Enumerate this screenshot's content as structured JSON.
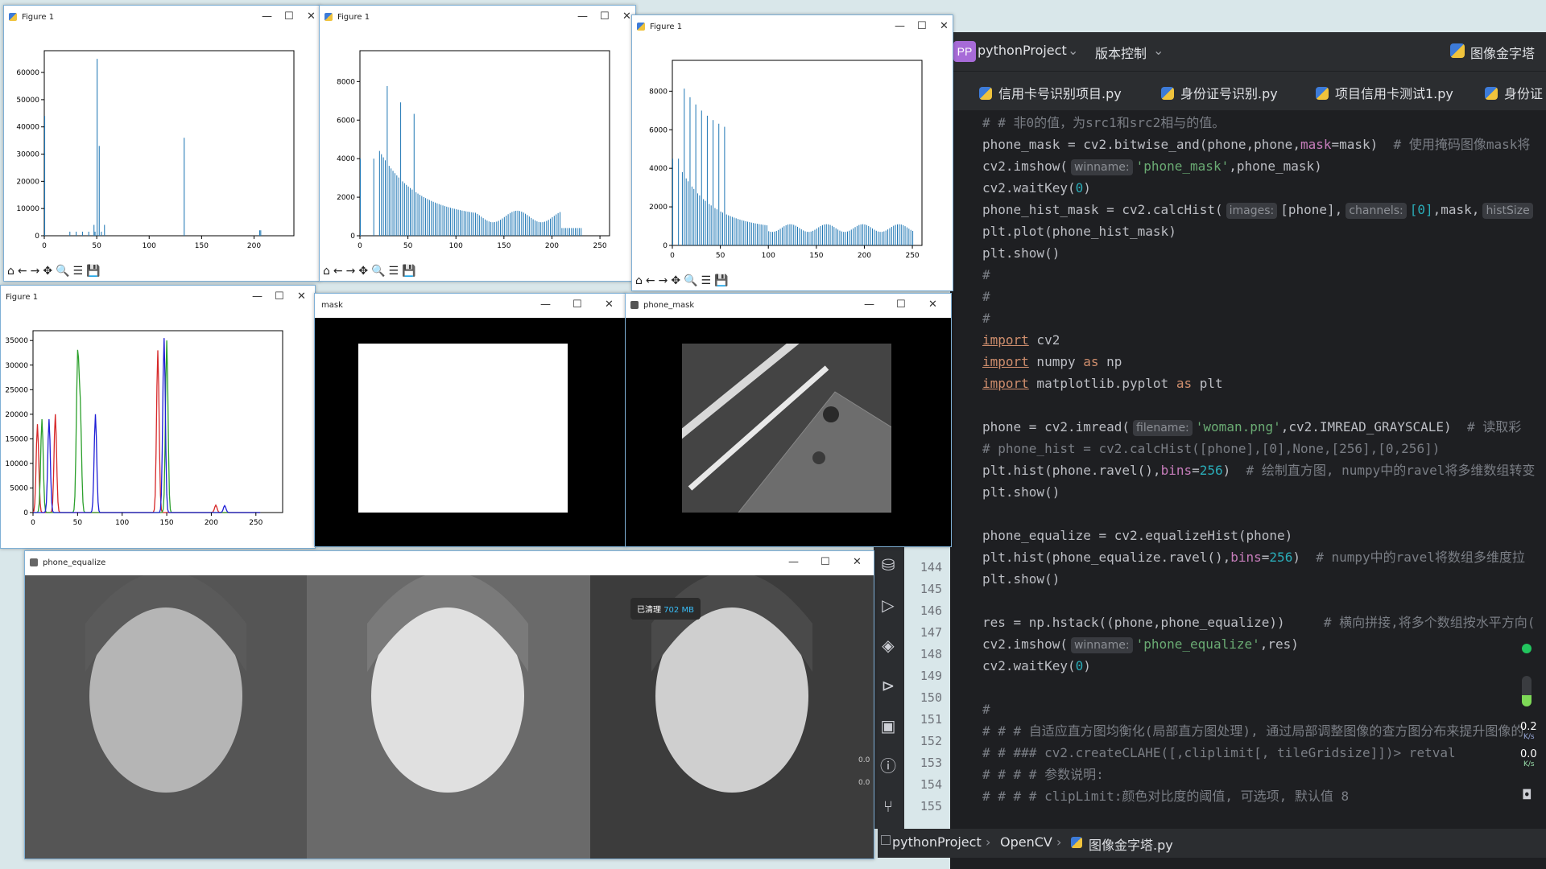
{
  "windows": {
    "fig1": {
      "title": "Figure 1",
      "yticks": [
        "0",
        "10000",
        "20000",
        "30000",
        "40000",
        "50000",
        "60000"
      ],
      "xticks": [
        "0",
        "50",
        "100",
        "150",
        "200"
      ]
    },
    "fig2": {
      "title": "Figure 1",
      "yticks": [
        "0",
        "2000",
        "4000",
        "6000",
        "8000"
      ],
      "xticks": [
        "0",
        "50",
        "100",
        "150",
        "200",
        "250"
      ]
    },
    "fig3": {
      "title": "Figure 1",
      "yticks": [
        "0",
        "2000",
        "4000",
        "6000",
        "8000"
      ],
      "xticks": [
        "0",
        "50",
        "100",
        "150",
        "200",
        "250"
      ]
    },
    "fig4": {
      "title": "Figure 1",
      "yticks": [
        "0",
        "5000",
        "10000",
        "15000",
        "20000",
        "25000",
        "30000",
        "35000"
      ],
      "xticks": [
        "0",
        "50",
        "100",
        "150",
        "200",
        "250"
      ]
    },
    "mask": {
      "title": "mask"
    },
    "phone_mask": {
      "title": "phone_mask"
    },
    "phone_equalize": {
      "title": "phone_equalize"
    },
    "controls": {
      "minimize": "—",
      "maximize": "☐",
      "close": "✕"
    },
    "toolbar": [
      "⌂",
      "←",
      "→",
      "✥",
      "🔍",
      "☰",
      "💾"
    ]
  },
  "cleanup_toast": {
    "label": "已清理",
    "value": "702 MB"
  },
  "net_speed": {
    "up": "0.2",
    "up_unit": "K/s",
    "down": "0.0",
    "down_unit": "K/s",
    "small_up": "0.0",
    "small_down": "0.0"
  },
  "ide": {
    "project_badge": "PP",
    "project_name": "pythonProject",
    "vcs": "版本控制",
    "current_file_top": "图像金字塔",
    "tabs": [
      "信用卡号识别项目.py",
      "身份证号识别.py",
      "项目信用卡测试1.py",
      "身份证"
    ],
    "breadcrumb": [
      "pythonProject",
      "OpenCV",
      "图像金字塔.py"
    ],
    "line_numbers": [
      "144",
      "145",
      "146",
      "147",
      "148",
      "149",
      "150",
      "151",
      "152",
      "153",
      "154",
      "155"
    ],
    "hints": {
      "winname": "winname:",
      "images": "images:",
      "channels": "channels:",
      "histsize": "histSize",
      "filename": "filename:"
    },
    "code": {
      "l1": "# # 非0的值，为src1和src2相与的值。",
      "l2a": "phone_mask = cv2.bitwise_and(phone,phone,",
      "l2b": "mask",
      "l2c": "=mask)  ",
      "l2d": "# 使用掩码图像mask将",
      "l3a": "cv2.imshow(",
      "l3b": "'phone_mask'",
      "l3c": ",phone_mask)",
      "l4a": "cv2.waitKey(",
      "l4b": "0",
      "l4c": ")",
      "l5a": "phone_hist_mask = cv2.calcHist(",
      "l5b": "[phone],",
      "l5c": "[0]",
      "l5d": ",mask,",
      "l6": "plt.plot(phone_hist_mask)",
      "l7": "plt.show()",
      "l8": "#",
      "l9": "#",
      "l10": "#",
      "l11a": "import",
      "l11b": " cv2",
      "l12a": "import",
      "l12b": " numpy ",
      "l12c": "as",
      "l12d": " np",
      "l13a": "import",
      "l13b": " matplotlib.pyplot ",
      "l13c": "as",
      "l13d": " plt",
      "l15a": "phone = cv2.imread(",
      "l15b": "'woman.png'",
      "l15c": ",cv2.IMREAD_GRAYSCALE)  ",
      "l15d": "# 读取彩",
      "l16": "# phone_hist = cv2.calcHist([phone],[0],None,[256],[0,256])",
      "l17a": "plt.hist(phone.ravel(),",
      "l17b": "bins",
      "l17c": "=",
      "l17d": "256",
      "l17e": ")  ",
      "l17f": "# 绘制直方图, numpy中的ravel将多维数组转变",
      "l18": "plt.show()",
      "l20": "phone_equalize = cv2.equalizeHist(phone)",
      "l21a": "plt.hist(phone_equalize.ravel(),",
      "l21b": "bins",
      "l21c": "=",
      "l21d": "256",
      "l21e": ")  ",
      "l21f": "# numpy中的ravel将数组多维度拉",
      "l22": "plt.show()",
      "l24a": "res = np.hstack((phone,phone_equalize))     ",
      "l24b": "# 横向拼接,将多个数组按水平方向(",
      "l25a": "cv2.imshow(",
      "l25b": "'phone_equalize'",
      "l25c": ",res)",
      "l26a": "cv2.waitKey(",
      "l26b": "0",
      "l26c": ")",
      "l28": "#",
      "l29": "# # # 自适应直方图均衡化(局部直方图处理), 通过局部调整图像的查方图分布来提升图像的",
      "l30": "# # ### cv2.createCLAHE([,cliplimit[, tileGridsize]])> retval",
      "l31": "# # # # 参数说明:",
      "l32": "# # # # clipLimit:颜色对比度的阈值, 可选项, 默认值 8"
    }
  },
  "colors": {
    "ide_bg": "#1e1f22",
    "accent_hist": "#1f77b4",
    "red": "#d62728",
    "green": "#2ca02c",
    "blue": "#1f1fd6"
  }
}
